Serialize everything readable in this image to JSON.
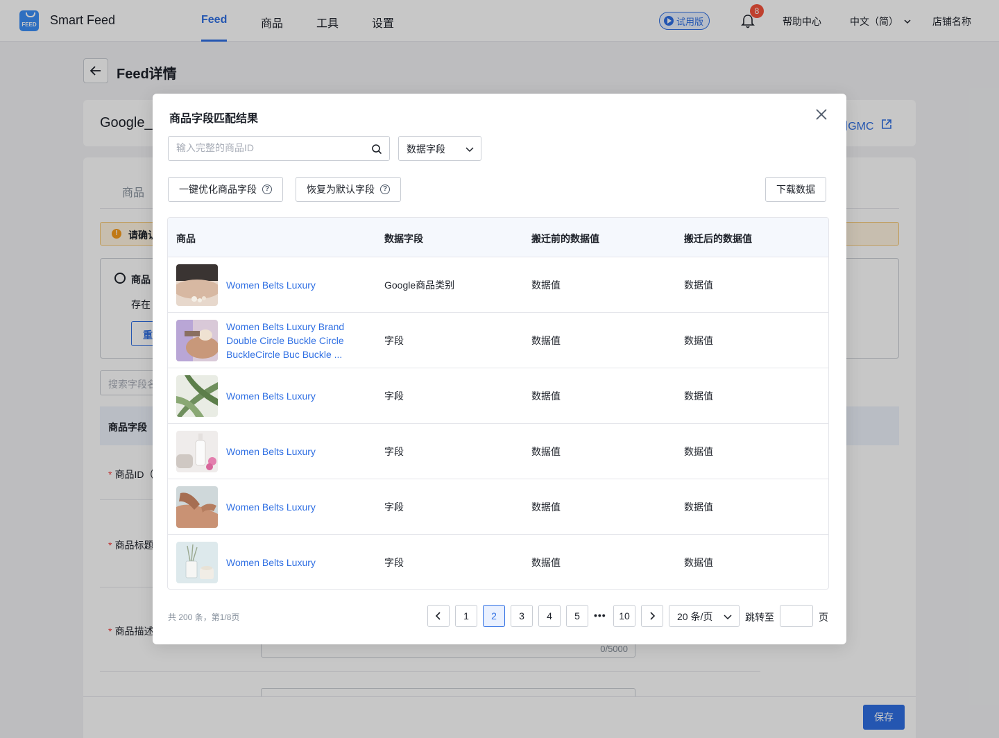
{
  "nav": {
    "brand": "Smart Feed",
    "logo_text": "FEED",
    "tabs": [
      "Feed",
      "商品",
      "工具",
      "设置"
    ],
    "active_tab": "Feed",
    "trial": "试用版",
    "notification_count": "8",
    "help": "帮助中心",
    "language": "中文（简）",
    "store": "店铺名称"
  },
  "page": {
    "title": "Feed详情",
    "feed_name": "Google_",
    "gmc_link": "问GMC",
    "tab": "商品",
    "warning": "请确认",
    "check_title": "商品",
    "check_text": "存在",
    "check_button": "重",
    "search_placeholder": "搜索字段名",
    "table_header": "商品字段",
    "field_id": "商品ID（",
    "field_title": "商品标题",
    "field_desc": "商品描述",
    "char_count": "0/5000",
    "save": "保存"
  },
  "modal": {
    "title": "商品字段匹配结果",
    "search_placeholder": "输入完整的商品ID",
    "field_select": "数据字段",
    "optimize_button": "一键优化商品字段",
    "restore_button": "恢复为默认字段",
    "download_button": "下载数据",
    "columns": [
      "商品",
      "数据字段",
      "搬迁前的数据值",
      "搬迁后的数据值"
    ],
    "rows": [
      {
        "name": "Women Belts Luxury",
        "field": "Google商品类别",
        "before": "数据值",
        "after": "数据值"
      },
      {
        "name": "Women Belts Luxury Brand Double Circle Buckle Circle BuckleCircle Buc Buckle ...",
        "field": "字段",
        "before": "数据值",
        "after": "数据值"
      },
      {
        "name": "Women Belts Luxury",
        "field": "字段",
        "before": "数据值",
        "after": "数据值"
      },
      {
        "name": "Women Belts Luxury",
        "field": "字段",
        "before": "数据值",
        "after": "数据值"
      },
      {
        "name": "Women Belts Luxury",
        "field": "字段",
        "before": "数据值",
        "after": "数据值"
      },
      {
        "name": "Women Belts Luxury",
        "field": "字段",
        "before": "数据值",
        "after": "数据值"
      }
    ],
    "pagination": {
      "total": "共 200 条，第1/8页",
      "pages": [
        "1",
        "2",
        "3",
        "4",
        "5",
        "10"
      ],
      "current": "2",
      "ellipsis": "•••",
      "page_size": "20 条/页",
      "jump_label": "跳转至",
      "page_label": "页"
    }
  },
  "colors": {
    "accent": "#2f6fe3",
    "badge": "#f5523b",
    "warning": "#f79b1e"
  }
}
